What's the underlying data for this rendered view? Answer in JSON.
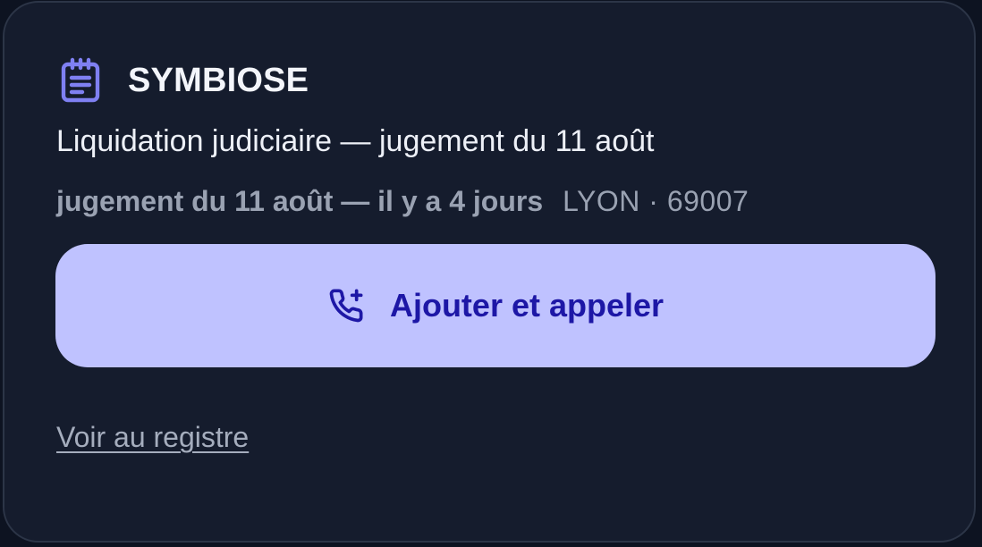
{
  "card": {
    "company_name": "SYMBIOSE",
    "title": "Liquidation judiciaire — jugement du 11 août",
    "meta_when": "jugement du 11 août — il y a 4 jours",
    "meta_where": "LYON · 69007",
    "header_icon": "notepad-icon",
    "cta": {
      "label": "Ajouter et appeler",
      "icon": "phone-plus-icon"
    },
    "link_label": "Voir au registre"
  },
  "colors": {
    "background": "#0d1321",
    "card_background": "#151c2d",
    "card_border": "#2c3547",
    "accent_icon": "#7f80f2",
    "button_background": "#bfc2ff",
    "button_text": "#1d17a6",
    "muted_text": "#9aa2b2"
  }
}
